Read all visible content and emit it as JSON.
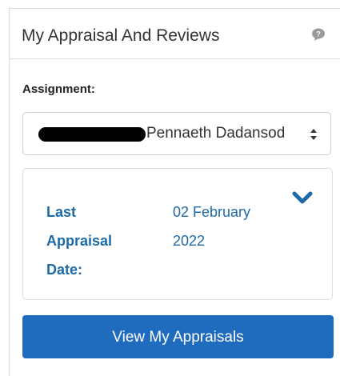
{
  "widget": {
    "title": "My Appraisal And Reviews",
    "help_icon": "speech-bubble-icon"
  },
  "assignment": {
    "label": "Assignment:",
    "selected_value": "Pennaeth Dadansod",
    "caret_icon": "up-down-caret-icon"
  },
  "appraisal": {
    "date_label": "Last Appraisal Date:",
    "date_value": "02 February 2022",
    "expand_icon": "chevron-down-icon"
  },
  "actions": {
    "view_button_label": "View My Appraisals"
  },
  "colors": {
    "link_blue": "#1c6aa8",
    "button_blue": "#1f6bbd",
    "border": "#dcdcdc"
  }
}
